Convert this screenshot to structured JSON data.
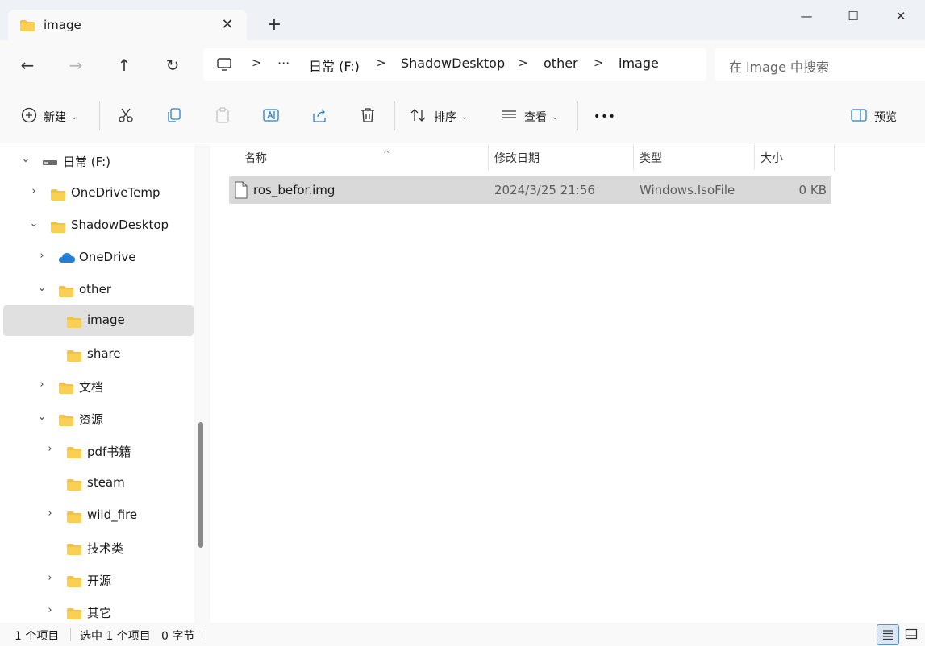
{
  "tab": {
    "title": "image",
    "close": "✕",
    "new_tab": "+"
  },
  "window": {
    "minimize": "—",
    "maximize": "☐",
    "close": "✕"
  },
  "nav": {
    "back": "←",
    "forward": "→",
    "up": "↑",
    "refresh": "↻"
  },
  "breadcrumb": {
    "overflow": "···",
    "items": [
      "日常 (F:)",
      "ShadowDesktop",
      "other",
      "image"
    ],
    "separator": ">"
  },
  "search": {
    "placeholder": "在 image 中搜索"
  },
  "toolbar": {
    "new_label": "新建",
    "sort_label": "排序",
    "view_label": "查看",
    "more": "•••",
    "preview_label": "预览",
    "caret": "⌄"
  },
  "sidebar": {
    "items": [
      {
        "label": "日常 (F:)",
        "chevron": "⌄",
        "icon": "drive-icon"
      },
      {
        "label": "OneDriveTemp",
        "chevron": "›",
        "icon": "folder-icon"
      },
      {
        "label": "ShadowDesktop",
        "chevron": "⌄",
        "icon": "folder-icon"
      },
      {
        "label": "OneDrive",
        "chevron": "›",
        "icon": "cloud-icon"
      },
      {
        "label": "other",
        "chevron": "⌄",
        "icon": "folder-icon"
      },
      {
        "label": "image",
        "chevron": "",
        "icon": "folder-icon",
        "selected": true
      },
      {
        "label": "share",
        "chevron": "",
        "icon": "folder-icon"
      },
      {
        "label": "文档",
        "chevron": "›",
        "icon": "folder-icon"
      },
      {
        "label": "资源",
        "chevron": "⌄",
        "icon": "folder-icon"
      },
      {
        "label": "pdf书籍",
        "chevron": "›",
        "icon": "folder-icon"
      },
      {
        "label": "steam",
        "chevron": "",
        "icon": "folder-icon"
      },
      {
        "label": "wild_fire",
        "chevron": "›",
        "icon": "folder-icon"
      },
      {
        "label": "技术类",
        "chevron": "",
        "icon": "folder-icon"
      },
      {
        "label": "开源",
        "chevron": "›",
        "icon": "folder-icon"
      },
      {
        "label": "其它",
        "chevron": "›",
        "icon": "folder-icon"
      }
    ]
  },
  "columns": {
    "name": "名称",
    "modified": "修改日期",
    "type": "类型",
    "size": "大小",
    "sort_indicator": "^"
  },
  "files": [
    {
      "name": "ros_befor.img",
      "modified": "2024/3/25 21:56",
      "type": "Windows.IsoFile",
      "size": "0 KB"
    }
  ],
  "status": {
    "count": "1 个项目",
    "selected": "选中 1 个项目",
    "bytes": "0 字节"
  },
  "colors": {
    "folder": "#f6c341",
    "folder_dark": "#e0a526",
    "accent": "#0067c0",
    "selected_row": "#d9d9d9"
  }
}
